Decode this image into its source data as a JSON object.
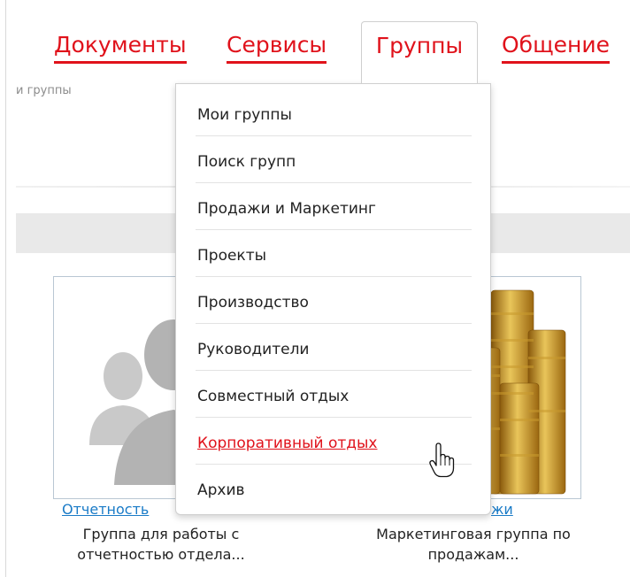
{
  "nav": {
    "tabs": [
      {
        "label": "Документы"
      },
      {
        "label": "Сервисы"
      },
      {
        "label": "Группы",
        "active": true
      },
      {
        "label": "Общение"
      }
    ]
  },
  "breadcrumb": "и группы",
  "dropdown": {
    "items": [
      {
        "label": "Мои группы"
      },
      {
        "label": "Поиск групп"
      },
      {
        "label": "Продажи и Маркетинг"
      },
      {
        "label": "Проекты"
      },
      {
        "label": "Производство"
      },
      {
        "label": "Руководители"
      },
      {
        "label": "Совместный отдых"
      },
      {
        "label": "Корпоративный отдых",
        "hovered": true
      },
      {
        "label": "Архив"
      }
    ]
  },
  "cards": [
    {
      "link": "Отчетность",
      "description_line1": "Группа для работы с",
      "description_line2": "отчетностью отдела..."
    },
    {
      "link": "жи",
      "description_line1": "Маркетинговая группа по",
      "description_line2": "продажам..."
    }
  ],
  "colors": {
    "accent": "#e0121b",
    "link": "#1a7bc7",
    "coin_gold": "#d4a32a"
  }
}
